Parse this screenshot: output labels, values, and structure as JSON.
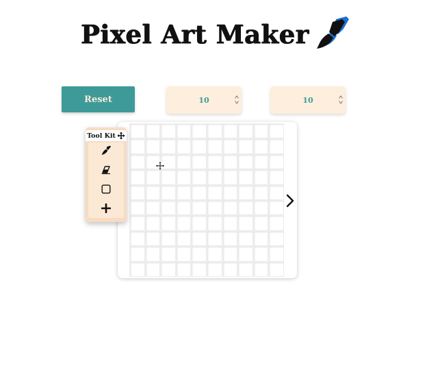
{
  "header": {
    "title": "Pixel Art Maker",
    "logo_icon": "paintbrush-icon"
  },
  "controls": {
    "reset_label": "Reset",
    "rows_value": "10",
    "cols_value": "10"
  },
  "toolkit": {
    "title": "Tool Kit",
    "drag_icon": "move-arrows-icon",
    "tools": [
      {
        "icon": "paintbrush-icon"
      },
      {
        "icon": "eraser-icon"
      },
      {
        "icon": "square-outline-icon"
      },
      {
        "icon": "plus-icon"
      }
    ]
  },
  "canvas": {
    "rows": 10,
    "cols": 10,
    "next_icon": "chevron-right-icon"
  },
  "colors": {
    "accent": "#3e9a98",
    "button_text": "#f6ecd8",
    "input_bg": "#fdeedd",
    "toolkit_bg": "#f7dcc2",
    "logo_brush_dark": "#111111",
    "logo_brush_blue": "#1f6fd1"
  }
}
